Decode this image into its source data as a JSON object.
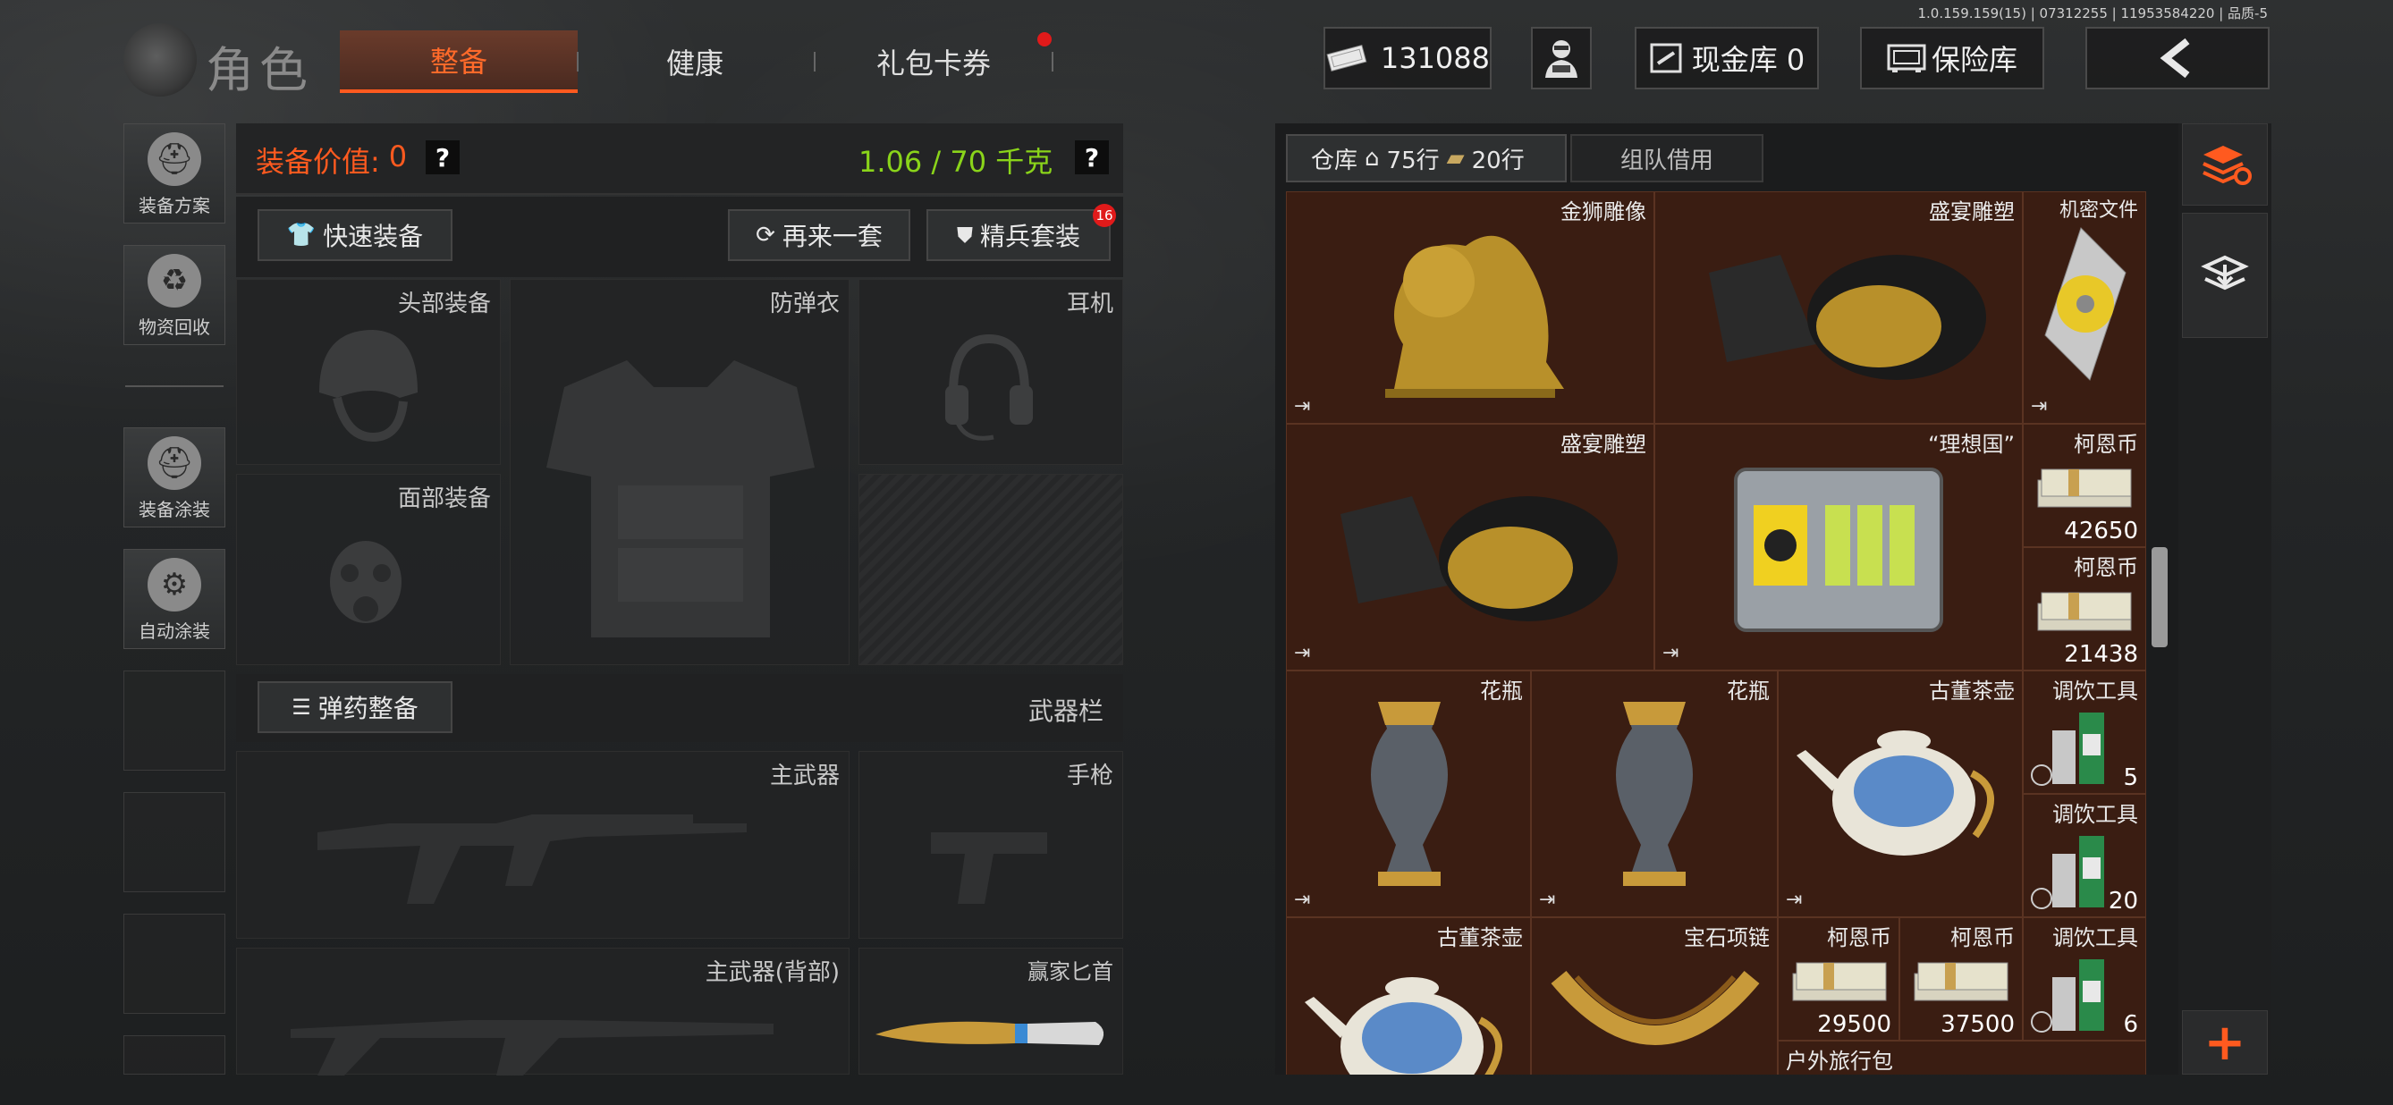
{
  "version": "1.0.159.159(15) | 07312255 | 11953584220 | 品质-5",
  "header": {
    "title": "角色",
    "tabs": [
      {
        "label": "整备",
        "active": true
      },
      {
        "label": "健康",
        "active": false
      },
      {
        "label": "礼包卡券",
        "active": false,
        "badge_dot": true
      }
    ],
    "currency": "131088",
    "cash_vault": "现金库 0",
    "safe_box": "保险库",
    "back_icon": "chevron-left-icon"
  },
  "sidebar": {
    "items": [
      {
        "label": "装备方案",
        "icon": "helmet-grid-icon"
      },
      {
        "label": "物资回收",
        "icon": "recycle-icon"
      },
      {
        "label": "装备涂装",
        "icon": "helmet-paint-icon"
      },
      {
        "label": "自动涂装",
        "icon": "brush-gear-icon"
      }
    ]
  },
  "equipment": {
    "value_label": "装备价值:",
    "value": "0",
    "weight": "1.06 / 70 千克",
    "help": "?",
    "quick_equip": "快速装备",
    "again_set": "再来一套",
    "elite_set": "精兵套装",
    "elite_badge": "16",
    "slots": {
      "head": "头部装备",
      "armor": "防弹衣",
      "headset": "耳机",
      "face": "面部装备",
      "primary": "主武器",
      "pistol": "手枪",
      "primary_back": "主武器(背部)",
      "knife": "赢家匕首"
    },
    "ammo": "弹药整备",
    "weapon_bar": "武器栏"
  },
  "warehouse": {
    "tab_label": "仓库",
    "rows_home": "75行",
    "rows_ticket": "20行",
    "team_borrow": "组队借用",
    "exit_mark": "⇥",
    "items": [
      {
        "name": "金狮雕像"
      },
      {
        "name": "盛宴雕塑"
      },
      {
        "name": "机密文件"
      },
      {
        "name": "盛宴雕塑"
      },
      {
        "name": "“理想国”"
      },
      {
        "name": "柯恩币",
        "count": "42650"
      },
      {
        "name": "柯恩币",
        "count": "21438"
      },
      {
        "name": "花瓶"
      },
      {
        "name": "花瓶"
      },
      {
        "name": "古董茶壶"
      },
      {
        "name": "调饮工具",
        "count": "5"
      },
      {
        "name": "调饮工具",
        "count": "20"
      },
      {
        "name": "古董茶壶"
      },
      {
        "name": "宝石项链"
      },
      {
        "name": "柯恩币",
        "count": "29500"
      },
      {
        "name": "柯恩币",
        "count": "37500"
      },
      {
        "name": "调饮工具",
        "count": "6"
      },
      {
        "name": "户外旅行包"
      }
    ]
  },
  "right_bar": {
    "sort_icon": "layers-refresh-icon",
    "import_icon": "layers-download-icon",
    "add": "+"
  }
}
